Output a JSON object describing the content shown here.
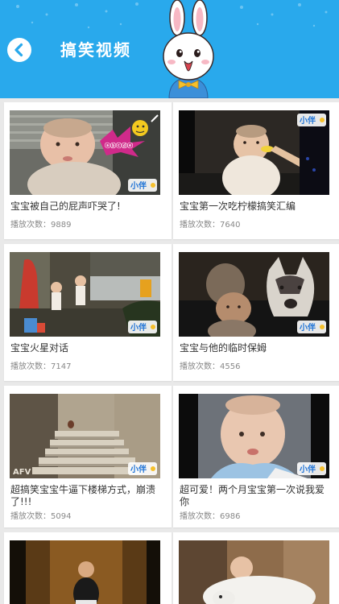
{
  "header": {
    "title": "搞笑视频",
    "bg_color": "#29a9ec",
    "back_icon": "chevron-left-icon",
    "mascot": "rabbit-mascot"
  },
  "play_count_label": "播放次数：",
  "videos": [
    {
      "title": "宝宝被自己的屁声吓哭了!",
      "plays": "9889",
      "watermark": "小伴龙"
    },
    {
      "title": "宝宝第一次吃柠檬搞笑汇编",
      "plays": "7640",
      "watermark": "小伴龙"
    },
    {
      "title": "宝宝火星对话",
      "plays": "7147",
      "watermark": "小伴龙"
    },
    {
      "title": "宝宝与他的临时保姆",
      "plays": "4556",
      "watermark": "小伴龙"
    },
    {
      "title": "超搞笑宝宝牛逼下楼梯方式，崩溃了!!!",
      "plays": "5094",
      "watermark": "小伴龙"
    },
    {
      "title": "超可爱！两个月宝宝第一次说我爱你",
      "plays": "6986",
      "watermark": "小伴龙"
    },
    {
      "title": "",
      "plays": ""
    },
    {
      "title": "",
      "plays": ""
    }
  ]
}
